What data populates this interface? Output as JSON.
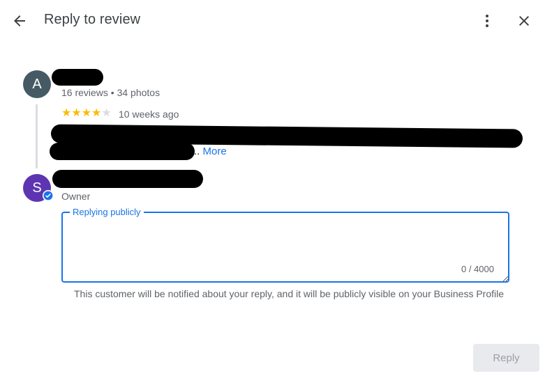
{
  "header": {
    "title": "Reply to review",
    "back_icon": "arrow-back-icon",
    "more_icon": "more-vert-icon",
    "close_icon": "close-icon"
  },
  "review": {
    "avatar_letter": "A",
    "reviewer_meta": "16 reviews • 34 photos",
    "rating": 4,
    "rating_max": 5,
    "time_ago": "10 weeks ago",
    "more_label": "More",
    "more_prefix": ".."
  },
  "owner": {
    "avatar_letter": "S",
    "role": "Owner",
    "verified_icon": "verified-check-icon"
  },
  "reply": {
    "legend": "Replying publicly",
    "value": "",
    "counter": "0 / 4000",
    "hint": "This customer will be notified about your reply, and it will be publicly visible on your Business Profile"
  },
  "actions": {
    "reply_label": "Reply"
  },
  "colors": {
    "accent": "#1a73e8",
    "star": "#fbbc04",
    "avatar_a": "#455a64",
    "avatar_s": "#5e35b1"
  }
}
